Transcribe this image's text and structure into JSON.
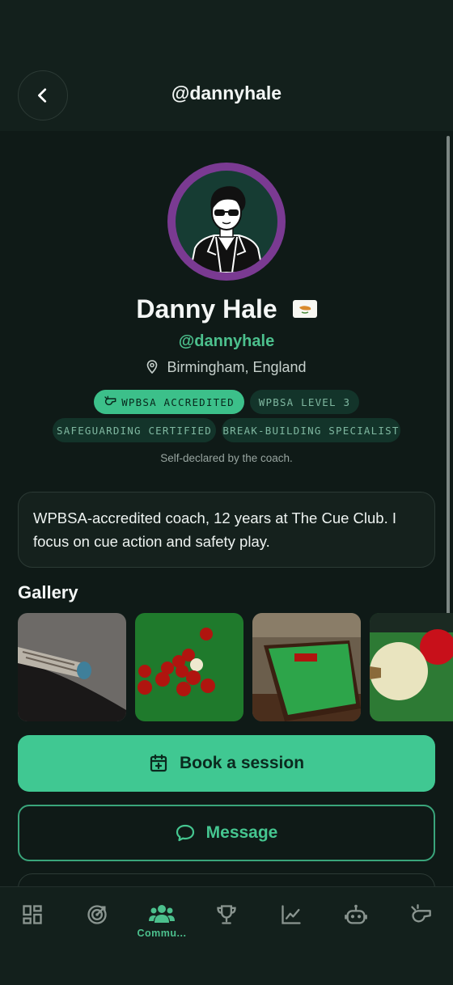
{
  "header": {
    "title": "@dannyhale",
    "back_icon": "chevron-left-icon"
  },
  "profile": {
    "name": "Danny Hale",
    "flag": "cyprus-flag-icon",
    "handle": "@dannyhale",
    "location": "Birmingham, England",
    "ring_color": "#7a3a92"
  },
  "badges": [
    {
      "label": "WPBSA ACCREDITED",
      "icon": "whistle-icon",
      "style": "primary"
    },
    {
      "label": "WPBSA LEVEL 3",
      "style": "muted"
    },
    {
      "label": "SAFEGUARDING CERTIFIED",
      "style": "muted"
    },
    {
      "label": "BREAK-BUILDING SPECIALIST",
      "style": "muted"
    }
  ],
  "disclaimer": "Self-declared by the coach.",
  "bio": "WPBSA-accredited coach, 12 years at The Cue Club. I focus on cue action and safety play.",
  "gallery": {
    "title": "Gallery",
    "items": [
      "cue-tip-photo",
      "red-balls-photo",
      "snooker-table-photo",
      "cue-ball-photo"
    ]
  },
  "actions": {
    "book_label": "Book a session",
    "message_label": "Message"
  },
  "tabbar": {
    "items": [
      {
        "icon": "dashboard-icon",
        "label": ""
      },
      {
        "icon": "target-icon",
        "label": ""
      },
      {
        "icon": "community-icon",
        "label": "Commu...",
        "active": true
      },
      {
        "icon": "trophy-icon",
        "label": ""
      },
      {
        "icon": "chart-icon",
        "label": ""
      },
      {
        "icon": "robot-icon",
        "label": ""
      },
      {
        "icon": "whistle-icon",
        "label": ""
      }
    ]
  },
  "colors": {
    "accent": "#40c892",
    "background": "#0f1a17"
  }
}
